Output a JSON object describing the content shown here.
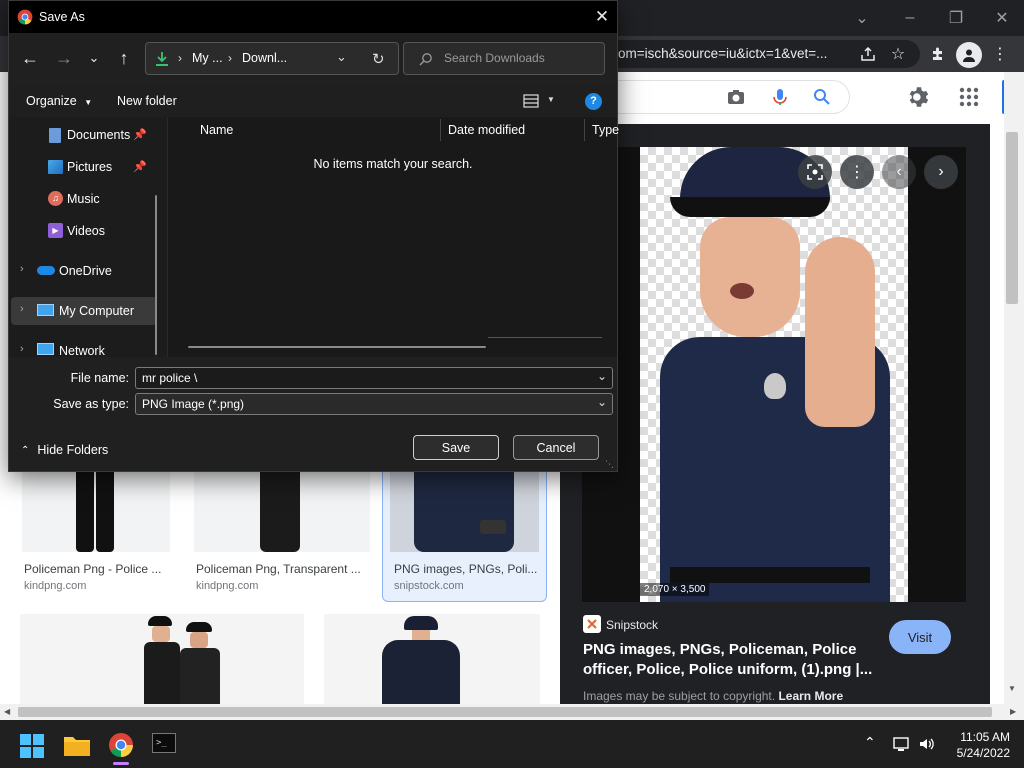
{
  "browser": {
    "omnibox_text": "om=isch&source=iu&ictx=1&vet=..."
  },
  "results": [
    {
      "title": "Policeman Png - Police ...",
      "source": "kindpng.com"
    },
    {
      "title": "Policeman Png, Transparent ...",
      "source": "kindpng.com"
    },
    {
      "title": "PNG images, PNGs, Poli...",
      "source": "snipstock.com"
    }
  ],
  "preview": {
    "dimensions": "2,070 × 3,500",
    "source_name": "Snipstock",
    "title_line1": "PNG images, PNGs, Policeman, Police",
    "title_line2": "officer, Police, Police uniform, (1).png |...",
    "visit_label": "Visit",
    "copyright_text": "Images may be subject to copyright.",
    "learn_more": "Learn More"
  },
  "dialog": {
    "title": "Save As",
    "breadcrumb": [
      "My ...",
      "Downl..."
    ],
    "search_placeholder": "Search Downloads",
    "organize_label": "Organize",
    "new_folder_label": "New folder",
    "nav_items": [
      {
        "label": "Documents",
        "icon": "documents-icon",
        "pinned": true
      },
      {
        "label": "Pictures",
        "icon": "pictures-icon",
        "pinned": true
      },
      {
        "label": "Music",
        "icon": "music-icon",
        "pinned": false
      },
      {
        "label": "Videos",
        "icon": "videos-icon",
        "pinned": false
      },
      {
        "label": "OneDrive",
        "icon": "onedrive-icon",
        "expandable": true
      },
      {
        "label": "My Computer",
        "icon": "computer-icon",
        "expandable": true,
        "selected": true
      },
      {
        "label": "Network",
        "icon": "network-icon",
        "expandable": true
      }
    ],
    "columns": [
      "Name",
      "Date modified",
      "Type"
    ],
    "empty_message": "No items match your search.",
    "file_name_label": "File name:",
    "file_name_value": "mr police \\",
    "save_type_label": "Save as type:",
    "save_type_value": "PNG Image (*.png)",
    "hide_folders_label": "Hide Folders",
    "save_label": "Save",
    "cancel_label": "Cancel"
  },
  "taskbar": {
    "time": "11:05 AM",
    "date": "5/24/2022"
  },
  "colors": {
    "chrome_dark": "#202124",
    "dialog_bg": "#202020",
    "accent_blue": "#8ab4f8",
    "selected_nav": "#3a3a3a"
  }
}
